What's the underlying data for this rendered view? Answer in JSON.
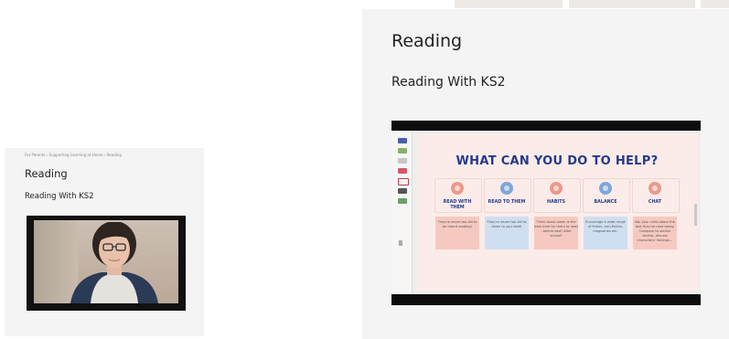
{
  "left_card": {
    "breadcrumb": "For Parents › Supporting Learning at Home › Reading",
    "title": "Reading",
    "subtitle": "Reading With KS2"
  },
  "right_card": {
    "title": "Reading",
    "subtitle": "Reading With KS2",
    "slide": {
      "title": "WHAT CAN YOU DO TO HELP?",
      "columns": [
        {
          "heading_line1": "READ WITH",
          "heading_line2": "THEM",
          "body": "They're never too old to be heard reading!",
          "color": "#f6c9c0",
          "icon_color": "#e99a8c"
        },
        {
          "heading_line1": "READ TO THEM",
          "heading_line2": "",
          "body": "They're never too old to listen to you read!",
          "color": "#cfdff1",
          "icon_color": "#7ea6d8"
        },
        {
          "heading_line1": "HABITS",
          "heading_line2": "",
          "body": "Think about when is the best time for them to read - before bed? After school?",
          "color": "#f6c9c0",
          "icon_color": "#e99a8c"
        },
        {
          "heading_line1": "BALANCE",
          "heading_line2": "",
          "body": "Encourage a wide range of fiction, non-fiction, magazines etc.",
          "color": "#cfdff1",
          "icon_color": "#7ea6d8"
        },
        {
          "heading_line1": "CHAT",
          "heading_line2": "",
          "body": "Ask your child about the text they've read today. Compare to similar stories, discuss characters' feelings...",
          "color": "#f6c9c0",
          "icon_color": "#e99a8c"
        }
      ]
    }
  },
  "colors": {
    "card_bg": "#f4f4f4",
    "slide_title": "#253a8c",
    "slide_bg": "#fbece9"
  }
}
